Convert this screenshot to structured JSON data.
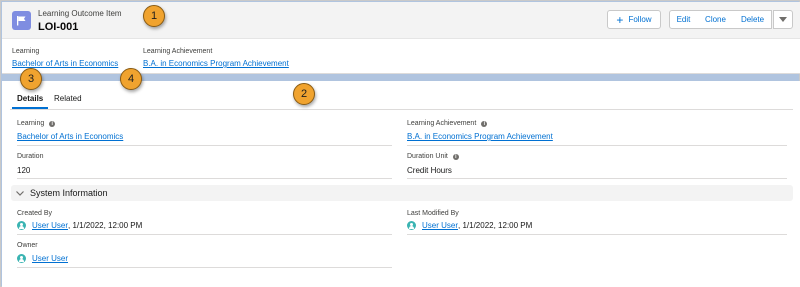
{
  "header": {
    "object_label": "Learning Outcome Item",
    "record_name": "LOI-001",
    "buttons": {
      "follow": "Follow",
      "edit": "Edit",
      "clone": "Clone",
      "delete": "Delete"
    },
    "highlights": {
      "learning_label": "Learning",
      "learning_value": "Bachelor of Arts in Economics",
      "achievement_label": "Learning Achievement",
      "achievement_value": "B.A. in Economics Program Achievement"
    }
  },
  "callouts": [
    "1",
    "2",
    "3",
    "4"
  ],
  "tabs": [
    "Details",
    "Related"
  ],
  "details": {
    "learning_label": "Learning",
    "learning_value": "Bachelor of Arts in Economics",
    "achievement_label": "Learning Achievement",
    "achievement_value": "B.A. in Economics Program Achievement",
    "duration_label": "Duration",
    "duration_value": "120",
    "duration_unit_label": "Duration Unit",
    "duration_unit_value": "Credit Hours"
  },
  "system_info": {
    "title": "System Information",
    "created_by_label": "Created By",
    "created_by_user": "User User",
    "created_by_date": ", 1/1/2022, 12:00 PM",
    "modified_by_label": "Last Modified By",
    "modified_by_user": "User User",
    "modified_by_date": ", 1/1/2022, 12:00 PM",
    "owner_label": "Owner",
    "owner_user": "User User"
  },
  "colors": {
    "accent": "#0070d2",
    "callout": "#f0a32f",
    "object_icon": "#7f8de1",
    "avatar": "#3bb4b2"
  },
  "icons": {
    "object": "flag-icon",
    "info": "info-icon",
    "avatar": "user-avatar-icon",
    "more": "chevron-down-icon"
  }
}
